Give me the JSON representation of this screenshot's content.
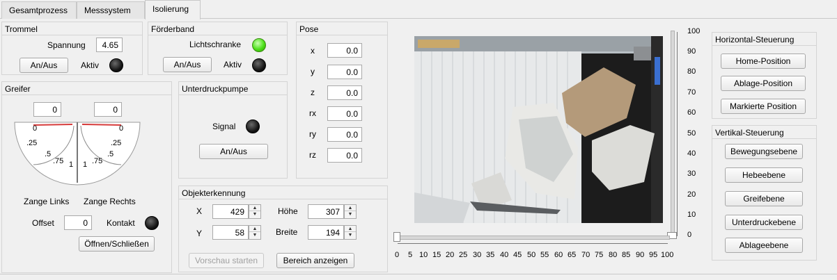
{
  "tabs": [
    {
      "label": "Gesamtprozess"
    },
    {
      "label": "Messsystem"
    },
    {
      "label": "Isolierung"
    }
  ],
  "trommel": {
    "title": "Trommel",
    "spannung_label": "Spannung",
    "spannung_value": "4.65",
    "onoff_label": "An/Aus",
    "aktiv_label": "Aktiv"
  },
  "foerderband": {
    "title": "Förderband",
    "lichtschranke_label": "Lichtschranke",
    "onoff_label": "An/Aus",
    "aktiv_label": "Aktiv"
  },
  "pose": {
    "title": "Pose",
    "rows": [
      {
        "label": "x",
        "value": "0.0"
      },
      {
        "label": "y",
        "value": "0.0"
      },
      {
        "label": "z",
        "value": "0.0"
      },
      {
        "label": "rx",
        "value": "0.0"
      },
      {
        "label": "ry",
        "value": "0.0"
      },
      {
        "label": "rz",
        "value": "0.0"
      }
    ]
  },
  "greifer": {
    "title": "Greifer",
    "left_value": "0",
    "right_value": "0",
    "gauge_left_ticks": [
      "0",
      ".25",
      ".5",
      ".75",
      "1"
    ],
    "gauge_right_ticks": [
      "0",
      ".25",
      ".5",
      ".75",
      "1"
    ],
    "zange_links_label": "Zange Links",
    "zange_rechts_label": "Zange Rechts",
    "offset_label": "Offset",
    "offset_value": "0",
    "kontakt_label": "Kontakt",
    "open_close_label": "Öffnen/Schließen"
  },
  "unterdruck": {
    "title": "Unterdruckpumpe",
    "signal_label": "Signal",
    "onoff_label": "An/Aus"
  },
  "objekt": {
    "title": "Objekterkennung",
    "x_label": "X",
    "x_value": "429",
    "y_label": "Y",
    "y_value": "58",
    "hoehe_label": "Höhe",
    "hoehe_value": "307",
    "breite_label": "Breite",
    "breite_value": "194",
    "preview_label": "Vorschau starten",
    "area_label": "Bereich anzeigen"
  },
  "slider_v": {
    "ticks": [
      "100",
      "90",
      "80",
      "70",
      "60",
      "50",
      "40",
      "30",
      "20",
      "10",
      "0"
    ]
  },
  "slider_h": {
    "ticks": [
      "0",
      "5",
      "10",
      "15",
      "20",
      "25",
      "30",
      "35",
      "40",
      "45",
      "50",
      "55",
      "60",
      "65",
      "70",
      "75",
      "80",
      "85",
      "90",
      "95",
      "100"
    ]
  },
  "horizontal": {
    "title": "Horizontal-Steuerung",
    "buttons": [
      "Home-Position",
      "Ablage-Position",
      "Markierte Position"
    ]
  },
  "vertikal": {
    "title": "Vertikal-Steuerung",
    "buttons": [
      "Bewegungsebene",
      "Hebeebene",
      "Greifebene",
      "Unterdruckebene",
      "Ablageebene"
    ]
  }
}
